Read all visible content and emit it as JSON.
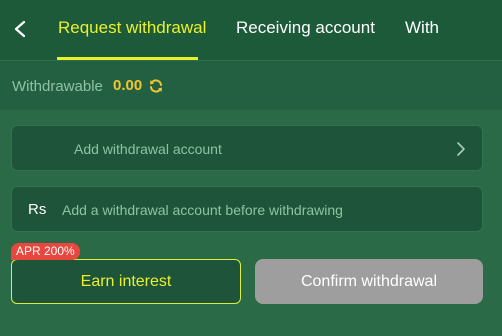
{
  "header": {
    "tabs": [
      {
        "label": "Request withdrawal",
        "active": true
      },
      {
        "label": "Receiving account",
        "active": false
      },
      {
        "label": "With",
        "active": false
      }
    ]
  },
  "withdrawable": {
    "label": "Withdrawable",
    "amount": "0.00"
  },
  "account_card": {
    "label": "Add withdrawal account"
  },
  "amount_card": {
    "currency": "Rs",
    "placeholder": "Add a withdrawal account before withdrawing"
  },
  "actions": {
    "apr_badge": "APR 200%",
    "earn_label": "Earn interest",
    "confirm_label": "Confirm withdrawal"
  },
  "colors": {
    "accent": "#e9f12f",
    "amount": "#f3c531",
    "badge": "#e8473f",
    "disabled_button": "#9e9e9e"
  }
}
